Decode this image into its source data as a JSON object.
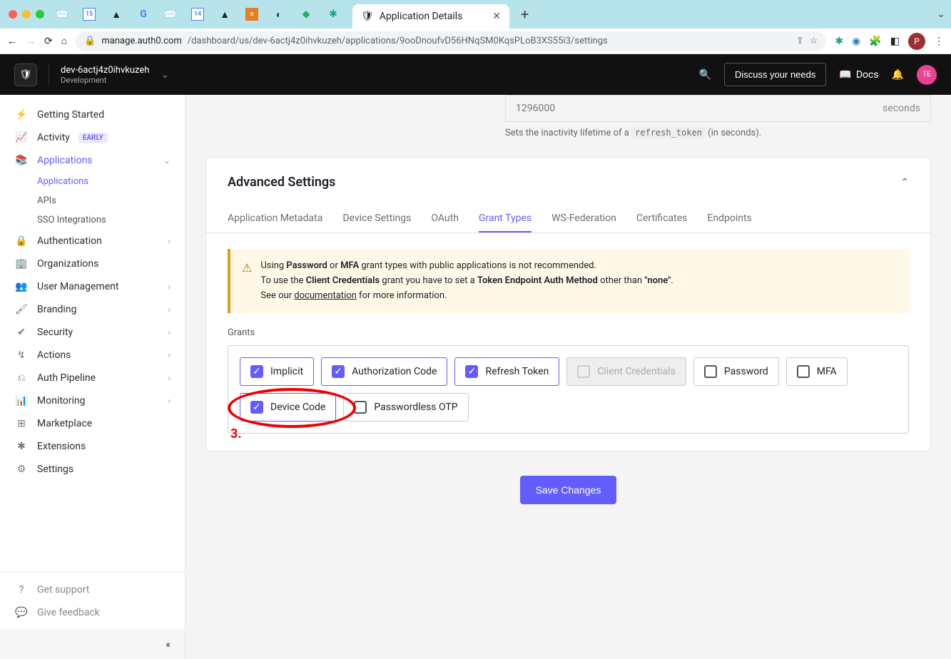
{
  "browser": {
    "tab_title": "Application Details",
    "url_host": "manage.auth0.com",
    "url_path": "/dashboard/us/dev-6actj4z0ihvkuzeh/applications/9ooDnoufvD56HNqSM0KqsPLoB3XS55i3/settings",
    "avatar_initial": "P"
  },
  "header": {
    "tenant": "dev-6actj4z0ihvkuzeh",
    "env": "Development",
    "discuss_label": "Discuss your needs",
    "docs_label": "Docs",
    "avatar_initials": "TE"
  },
  "sidebar": {
    "items": [
      {
        "label": "Getting Started",
        "icon": "⚡"
      },
      {
        "label": "Activity",
        "icon": "📈",
        "badge": "EARLY"
      },
      {
        "label": "Applications",
        "icon": "📚",
        "active": true,
        "expand": "down",
        "sub": [
          {
            "label": "Applications",
            "active": true
          },
          {
            "label": "APIs"
          },
          {
            "label": "SSO Integrations"
          }
        ]
      },
      {
        "label": "Authentication",
        "icon": "🔒",
        "expand": "right"
      },
      {
        "label": "Organizations",
        "icon": "🏢"
      },
      {
        "label": "User Management",
        "icon": "👥",
        "expand": "right"
      },
      {
        "label": "Branding",
        "icon": "🖌",
        "expand": "right"
      },
      {
        "label": "Security",
        "icon": "✔",
        "expand": "right"
      },
      {
        "label": "Actions",
        "icon": "↯",
        "expand": "right"
      },
      {
        "label": "Auth Pipeline",
        "icon": "⎌",
        "expand": "right"
      },
      {
        "label": "Monitoring",
        "icon": "📊",
        "expand": "right"
      },
      {
        "label": "Marketplace",
        "icon": "⊞"
      },
      {
        "label": "Extensions",
        "icon": "✱"
      },
      {
        "label": "Settings",
        "icon": "⚙"
      }
    ],
    "footer": [
      {
        "label": "Get support",
        "icon": "?"
      },
      {
        "label": "Give feedback",
        "icon": "💬"
      }
    ]
  },
  "refresh": {
    "value": "1296000",
    "unit": "seconds",
    "help_prefix": "Sets the inactivity lifetime of a ",
    "help_code": "refresh_token",
    "help_suffix": " (in seconds)."
  },
  "advanced": {
    "title": "Advanced Settings",
    "tabs": [
      "Application Metadata",
      "Device Settings",
      "OAuth",
      "Grant Types",
      "WS-Federation",
      "Certificates",
      "Endpoints"
    ],
    "active_tab_index": 3,
    "warning": {
      "l1a": "Using ",
      "l1pw": "Password",
      "l1or": " or ",
      "l1mfa": "MFA",
      "l1b": " grant types with public applications is not recommended.",
      "l2a": "To use the ",
      "l2cc": "Client Credentials",
      "l2b": " grant you have to set a ",
      "l2te": "Token Endpoint Auth Method",
      "l2c": " other than ",
      "l2none": "\"none\"",
      "l2d": ".",
      "l3a": "See our ",
      "l3link": "documentation",
      "l3b": " for more information."
    },
    "grants_label": "Grants",
    "grants": [
      {
        "label": "Implicit",
        "checked": true
      },
      {
        "label": "Authorization Code",
        "checked": true
      },
      {
        "label": "Refresh Token",
        "checked": true
      },
      {
        "label": "Client Credentials",
        "checked": false,
        "disabled": true
      },
      {
        "label": "Password",
        "checked": false
      },
      {
        "label": "MFA",
        "checked": false
      },
      {
        "label": "Device Code",
        "checked": true,
        "highlighted": true
      },
      {
        "label": "Passwordless OTP",
        "checked": false
      }
    ],
    "highlight_number": "3."
  },
  "save_label": "Save Changes"
}
